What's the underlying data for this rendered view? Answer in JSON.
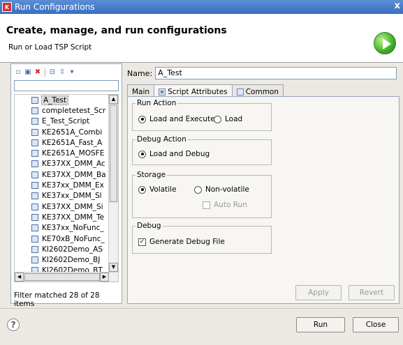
{
  "window": {
    "title": "Run Configurations",
    "close_symbol": "x"
  },
  "header": {
    "title": "Create, manage, and run configurations",
    "subtitle": "Run or Load TSP Script"
  },
  "left": {
    "filter_value": "",
    "items": [
      "A_Test",
      "completetest_Scr",
      "E_Test_Script",
      "KE2651A_Combi",
      "KE2651A_Fast_A",
      "KE2651A_MOSFE",
      "KE37XX_DMM_Ac",
      "KE37XX_DMM_Ba",
      "KE37xx_DMM_Ex",
      "KE37xx_DMM_Sl",
      "KE37XX_DMM_Si",
      "KE37XX_DMM_Te",
      "KE37xx_NoFunc_",
      "KE70xB_NoFunc_",
      "KI2602Demo_AS",
      "KI2602Demo_BJ",
      "KI2602Demo_BT"
    ],
    "selected_index": 0,
    "status": "Filter matched 28 of 28 items"
  },
  "right": {
    "name_label": "Name:",
    "name_value": "A_Test",
    "tabs": [
      "Main",
      "Script Attributes",
      "Common"
    ],
    "active_tab": 1,
    "run_action": {
      "legend": "Run Action",
      "opt1": "Load and Execute",
      "opt2": "Load"
    },
    "debug_action": {
      "legend": "Debug Action",
      "opt1": "Load and Debug"
    },
    "storage": {
      "legend": "Storage",
      "opt1": "Volatile",
      "opt2": "Non-volatile",
      "auto_run": "Auto Run"
    },
    "debug": {
      "legend": "Debug",
      "generate": "Generate Debug File"
    },
    "apply_label": "Apply",
    "revert_label": "Revert"
  },
  "footer": {
    "help_symbol": "?",
    "run_label": "Run",
    "close_label": "Close"
  }
}
